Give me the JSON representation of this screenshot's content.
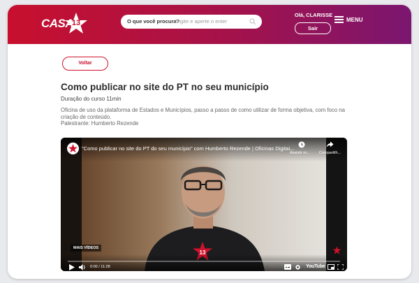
{
  "header": {
    "logo_text": "CASA",
    "logo_number": "13",
    "search_label": "O que você procura?",
    "search_placeholder": "Digite e aperte o enter",
    "greeting": "Olá, CLARISSE",
    "logout_label": "Sair",
    "menu_label": "MENU",
    "gradient_start": "#c8102e",
    "gradient_end": "#7b1670"
  },
  "main": {
    "back_label": "Voltar",
    "title": "Como publicar no site do PT no seu município",
    "duration": "Duração do curso 11min",
    "description": "Oficina de uso da plataforma de Estados e Municípios, passo a passo de como utilizar de forma objetiva, com foco na criação de conteúdo.",
    "speaker": "Palestrante: Humberto Rezende"
  },
  "video": {
    "title": "\"Como publicar no site do PT do seu município\" com Humberto Rezende | Oficinas Digitai...",
    "watch_later": "Assistir m...",
    "share": "Compartilh...",
    "more_videos": "MAIS VÍDEOS",
    "time": "0:00 / 11:28",
    "progress": 0.0,
    "youtube_label": "YouTube",
    "badge_number": "13"
  }
}
